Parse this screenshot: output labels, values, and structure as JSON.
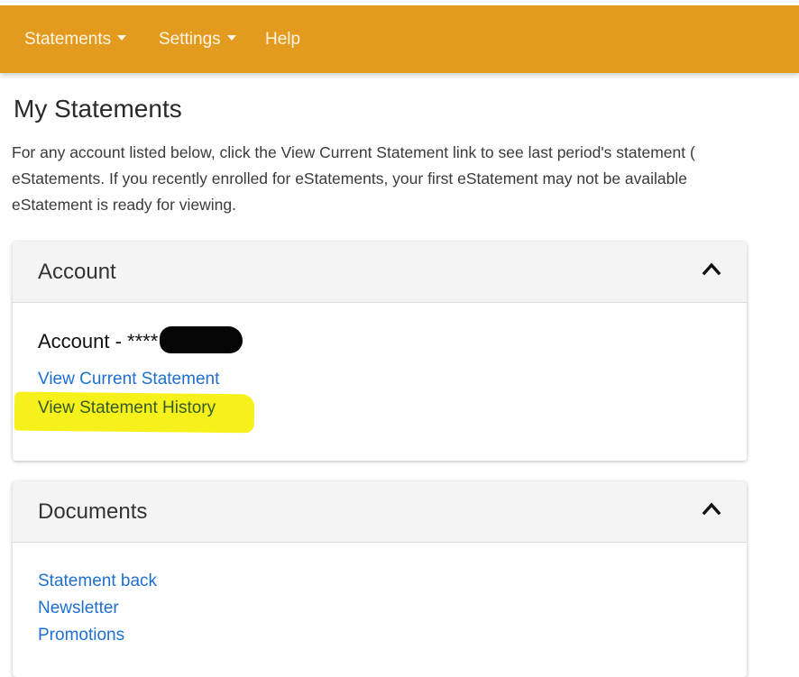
{
  "nav": {
    "statements_label": "Statements",
    "settings_label": "Settings",
    "help_label": "Help"
  },
  "page": {
    "title": "My Statements",
    "intro_lines": [
      "For any account listed below, click the View Current Statement link to see last period's statement (",
      "eStatements. If you recently enrolled for eStatements, your first eStatement may not be available",
      "eStatement is ready for viewing."
    ]
  },
  "account_panel": {
    "header": "Account",
    "account_label": "Account - ****",
    "links": {
      "current": "View Current Statement",
      "history": "View Statement History"
    }
  },
  "documents_panel": {
    "header": "Documents",
    "links": [
      "Statement back",
      "Newsletter",
      "Promotions"
    ]
  },
  "colors": {
    "nav_bg": "#e39b1f",
    "link": "#1f6fd1",
    "highlight": "#f6f11a"
  },
  "icons": {
    "nav_dropdown": "caret-down-icon",
    "panel_toggle": "chevron-up-icon"
  }
}
